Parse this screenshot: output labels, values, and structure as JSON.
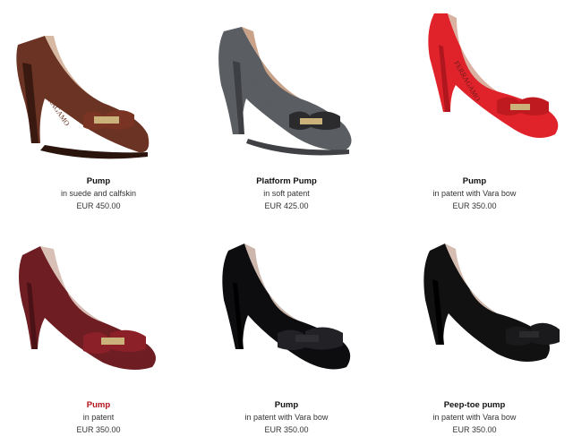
{
  "products": [
    {
      "name": "Pump",
      "desc": "in suede and calfskin",
      "price": "EUR 450.00",
      "color": "#6b3323",
      "active": false
    },
    {
      "name": "Platform Pump",
      "desc": "in soft patent",
      "price": "EUR 425.00",
      "color": "#5a5d61",
      "active": false
    },
    {
      "name": "Pump",
      "desc": "in patent with Vara bow",
      "price": "EUR 350.00",
      "color": "#e0232b",
      "active": false
    },
    {
      "name": "Pump",
      "desc": "in patent",
      "price": "EUR 350.00",
      "color": "#6e1e22",
      "active": true
    },
    {
      "name": "Pump",
      "desc": "in patent with Vara bow",
      "price": "EUR 350.00",
      "color": "#0d0d10",
      "active": false
    },
    {
      "name": "Peep-toe pump",
      "desc": "in patent with Vara bow",
      "price": "EUR 350.00",
      "color": "#111111",
      "active": false
    }
  ],
  "colors": {
    "active_name": "#b3131b",
    "lining": "#d7b9a3",
    "bow_plate": "#cbb27a"
  },
  "logo_text": "FERRAGAMO"
}
